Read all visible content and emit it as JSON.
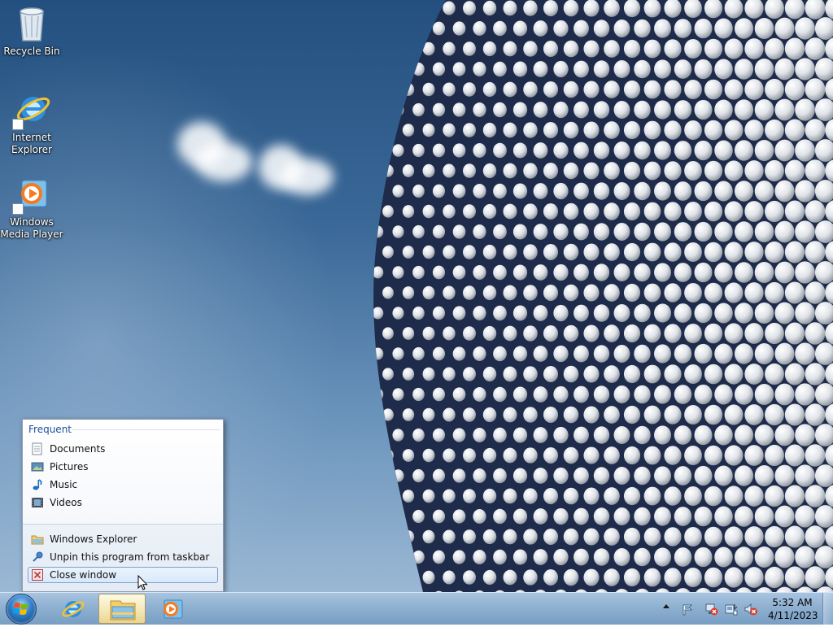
{
  "desktop": {
    "icons": [
      {
        "label": "Recycle Bin",
        "icon": "recycle-bin-icon"
      },
      {
        "label": "Internet Explorer",
        "icon": "internet-explorer-icon"
      },
      {
        "label": "Windows Media Player",
        "icon": "windows-media-player-icon"
      }
    ]
  },
  "jumplist": {
    "heading": "Frequent",
    "frequent": [
      {
        "label": "Documents",
        "icon": "documents-library-icon"
      },
      {
        "label": "Pictures",
        "icon": "pictures-library-icon"
      },
      {
        "label": "Music",
        "icon": "music-library-icon"
      },
      {
        "label": "Videos",
        "icon": "videos-library-icon"
      }
    ],
    "tasks": [
      {
        "label": "Windows Explorer",
        "icon": "folder-icon"
      },
      {
        "label": "Unpin this program from taskbar",
        "icon": "unpin-icon"
      },
      {
        "label": "Close window",
        "icon": "close-window-icon",
        "hovered": true
      }
    ]
  },
  "taskbar": {
    "pinned": [
      "internet-explorer-icon",
      "windows-explorer-icon",
      "windows-media-player-icon"
    ],
    "active_item": "windows-explorer-icon",
    "tray_icons": [
      "show-hidden-icons-chevron",
      "action-center-icon",
      "network-disconnected-icon",
      "power-icon",
      "volume-muted-icon"
    ],
    "clock": {
      "time": "5:32 AM",
      "date": "4/11/2023"
    }
  },
  "colors": {
    "sky_top": "#24507f",
    "accent_heading": "#1d4fa0",
    "hover_border": "#7da2ce"
  }
}
